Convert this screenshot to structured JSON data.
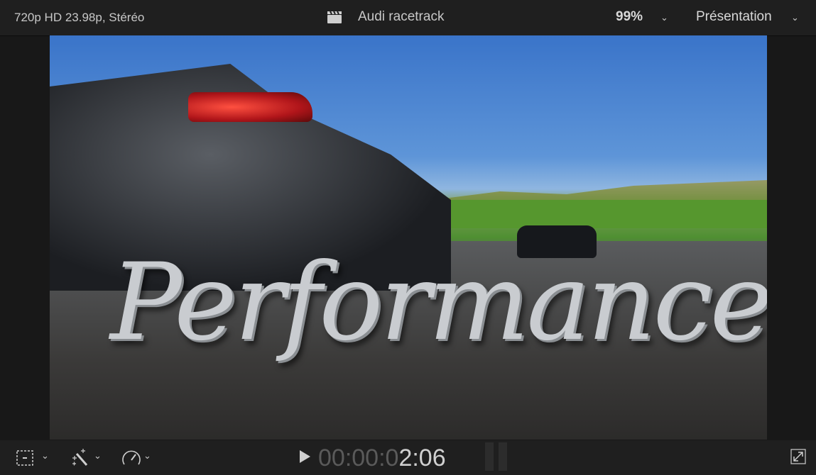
{
  "header": {
    "format": "720p HD 23.98p, Stéréo",
    "clip_icon": "clapperboard-icon",
    "title": "Audi racetrack",
    "zoom": "99%",
    "view_menu": "Présentation"
  },
  "viewer": {
    "overlay_title": "Performance"
  },
  "footer": {
    "transform_icon": "transform-icon",
    "enhance_icon": "magic-wand-icon",
    "speed_icon": "speedometer-icon",
    "timecode_dim": "00:00:0",
    "timecode_active": "2:06",
    "fullscreen_icon": "fullscreen-icon"
  }
}
